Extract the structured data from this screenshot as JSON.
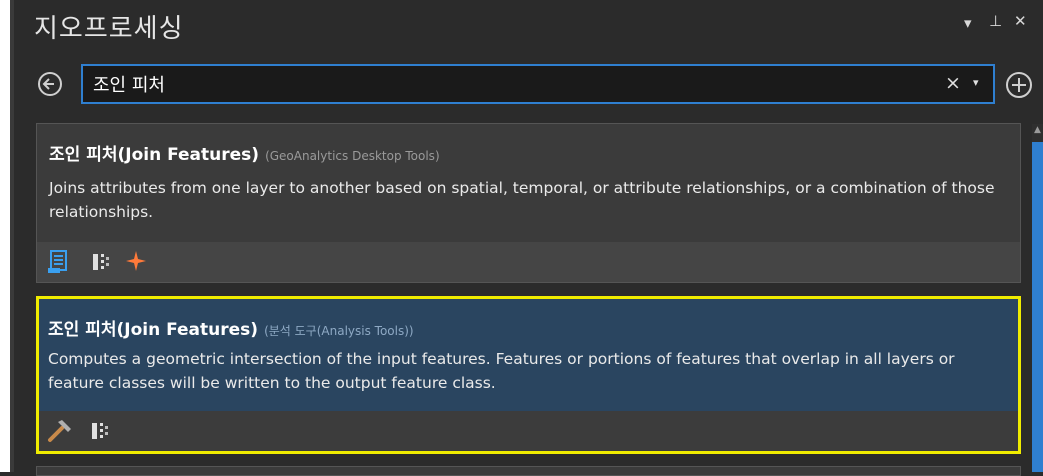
{
  "panel": {
    "title": "지오프로세싱",
    "controls": {
      "dropdown": "▾",
      "pin": "⊥",
      "close": "✕"
    }
  },
  "search": {
    "value": "조인 피처",
    "placeholder": "",
    "clear_glyph": "×",
    "dropdown_glyph": "▾"
  },
  "results": [
    {
      "name": "조인 피처(Join Features)",
      "source": "(GeoAnalytics Desktop Tools)",
      "description": "Joins attributes from one layer to another based on spatial, temporal, or attribute relationships, or a combination of those relationships.",
      "selected": false,
      "icons": [
        "script-icon",
        "parallel-processing-icon",
        "geoanalytics-spark-icon"
      ]
    },
    {
      "name": "조인 피처(Join Features)",
      "source": "(분석 도구(Analysis Tools))",
      "description": "Computes a geometric intersection of the input features. Features or portions of features that overlap in all layers or feature classes will be written to the output feature class.",
      "selected": true,
      "icons": [
        "hammer-tool-icon",
        "parallel-processing-icon"
      ]
    }
  ],
  "colors": {
    "accent": "#2f7fd0",
    "selection_border": "#f0ec00",
    "selected_bg": "#2a4560"
  }
}
